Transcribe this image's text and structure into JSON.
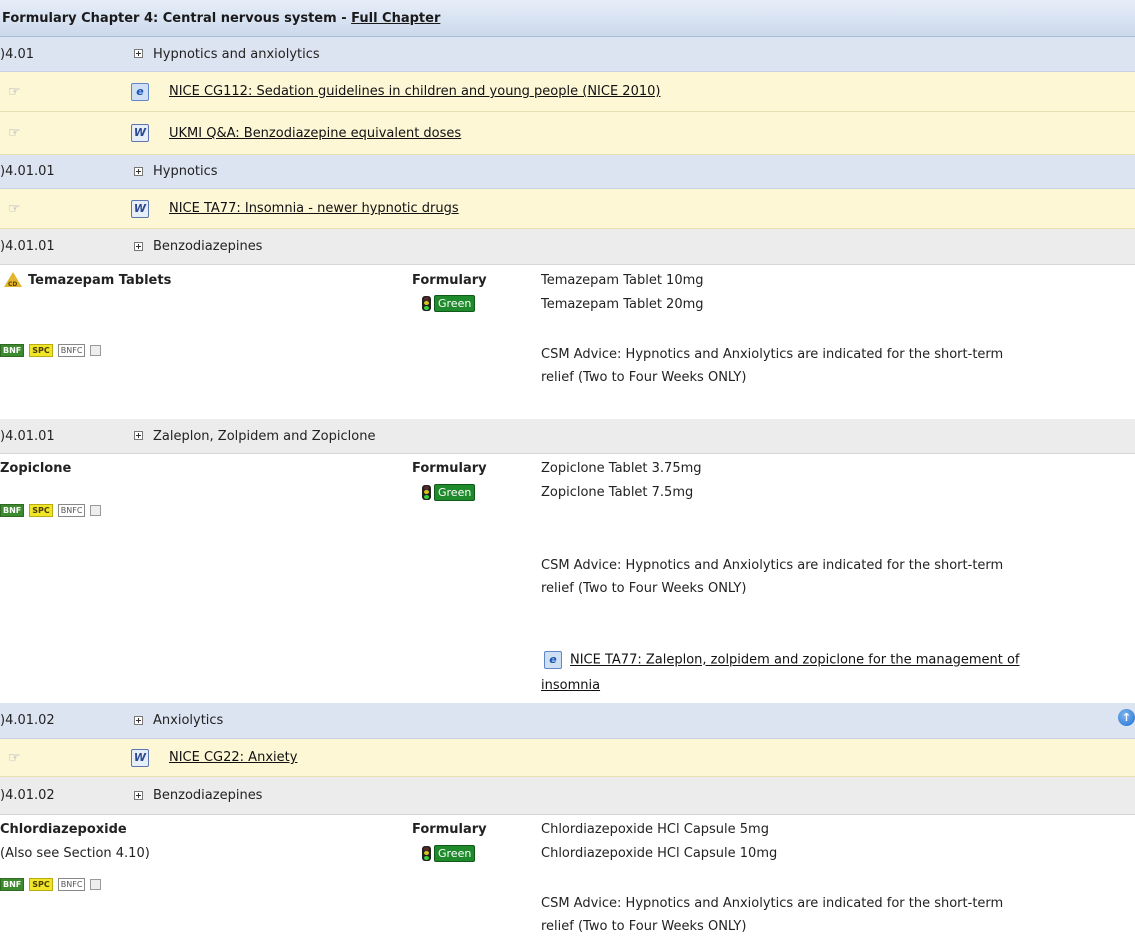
{
  "header": {
    "title": "Formulary Chapter 4: Central nervous system - ",
    "full_chapter": "Full Chapter"
  },
  "rows": {
    "s1": {
      "code": ")4.01",
      "title": "Hypnotics and anxiolytics"
    },
    "l1": {
      "text": "NICE CG112: Sedation guidelines in children and young people (NICE 2010)",
      "icon": "ie-icon"
    },
    "l2": {
      "text": "UKMI Q&A: Benzodiazepine equivalent doses",
      "icon": "word-doc-icon"
    },
    "s2": {
      "code": ")4.01.01",
      "title": "Hypnotics"
    },
    "l3": {
      "text": "NICE TA77: Insomnia - newer hypnotic drugs",
      "icon": "word-doc-icon"
    },
    "s3": {
      "code": ")4.01.01",
      "title": "Benzodiazepines"
    },
    "s4": {
      "code": ")4.01.01",
      "title": "Zaleplon, Zolpidem and Zopiclone"
    },
    "s5": {
      "code": ")4.01.02",
      "title": "Anxiolytics"
    },
    "l4": {
      "text": "NICE CG22: Anxiety",
      "icon": "word-doc-icon"
    },
    "s6": {
      "code": ")4.01.02",
      "title": "Benzodiazepines"
    }
  },
  "hand_glyph": "☞",
  "ie_glyph": "e",
  "word_glyph": "W",
  "plus_glyph": "",
  "warn_label": "CD",
  "up_glyph": "↑",
  "badges": {
    "bnf": "BNF",
    "spc": "SPC",
    "bnfc": "BNFC",
    "pic": ""
  },
  "status": {
    "formulary": "Formulary",
    "green": "Green"
  },
  "drugs": {
    "temazepam": {
      "name": "Temazepam Tablets",
      "products": [
        "Temazepam Tablet 10mg",
        "Temazepam Tablet 20mg"
      ],
      "advice_1": "CSM Advice: Hypnotics and Anxiolytics are indicated for the short-term",
      "advice_2": "relief (Two to Four Weeks ONLY)"
    },
    "zopiclone": {
      "name": "Zopiclone",
      "products": [
        "Zopiclone Tablet 3.75mg",
        "Zopiclone Tablet 7.5mg"
      ],
      "advice_1": "CSM Advice: Hypnotics and Anxiolytics are indicated for the short-term",
      "advice_2": "relief (Two to Four Weeks ONLY)",
      "link_1": "NICE TA77: Zaleplon, zolpidem and zopiclone for the management of",
      "link_2": "insomnia"
    },
    "chlordiazepoxide": {
      "name": "Chlordiazepoxide",
      "note": "(Also see Section 4.10)",
      "products": [
        "Chlordiazepoxide HCl Capsule 5mg",
        "Chlordiazepoxide HCl Capsule 10mg"
      ],
      "advice_1": "CSM Advice: Hypnotics and Anxiolytics are indicated for the short-term",
      "advice_2": "relief (Two to Four Weeks ONLY)"
    }
  },
  "colors": {
    "section_bg": "#dde4f1",
    "subsection_bg": "#ececec",
    "link_bg": "#fdf7d6",
    "green_status": "#1f8a2c"
  }
}
